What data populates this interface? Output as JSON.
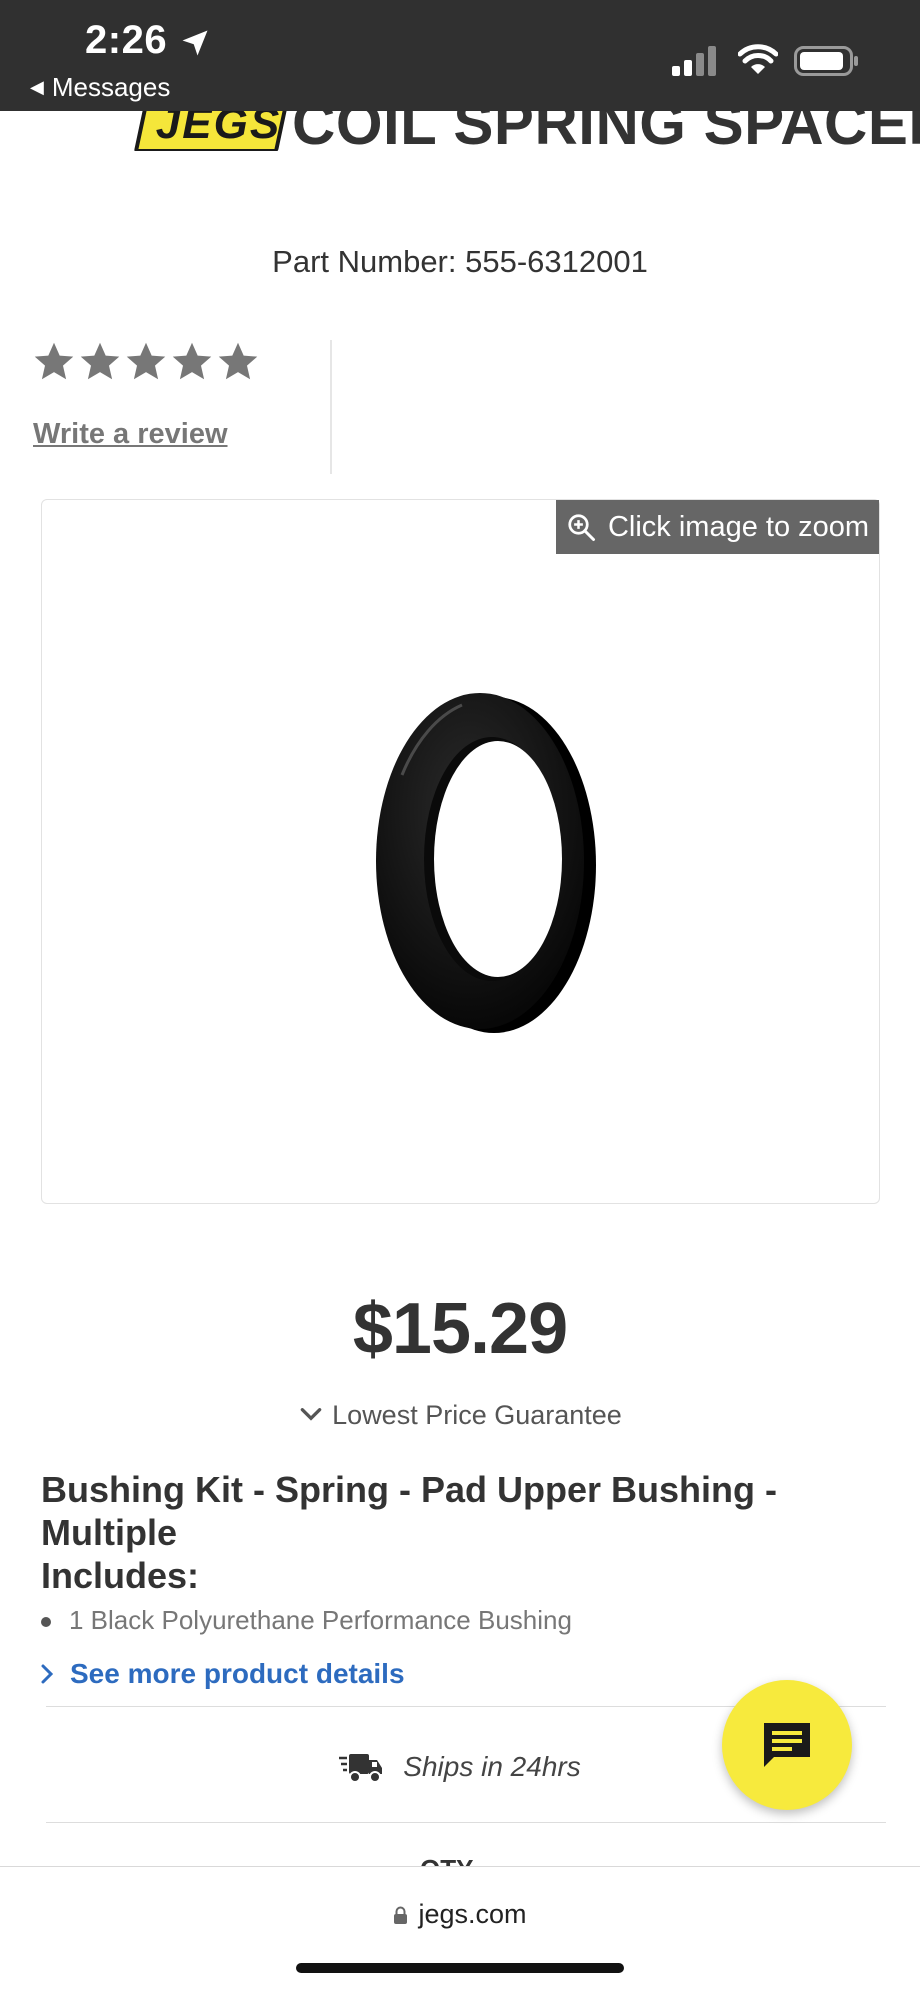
{
  "status_bar": {
    "time": "2:26",
    "back_label": "Messages"
  },
  "header": {
    "logo_text": "JEGS",
    "title": "COIL SPRING SPACER"
  },
  "product": {
    "part_number": "Part Number: 555-6312001",
    "rating_stars": 5,
    "write_review": "Write a review",
    "zoom_label": "Click image to zoom",
    "price": "$15.29",
    "price_guarantee": "Lowest Price Guarantee",
    "description_title": "Bushing Kit - Spring - Pad Upper Bushing - Multiple",
    "includes_label": "Includes:",
    "includes": [
      "1 Black Polyurethane Performance Bushing"
    ],
    "more_details": "See more product details",
    "shipping": "Ships in 24hrs",
    "qty_label": "QTY"
  },
  "browser": {
    "url": "jegs.com"
  },
  "colors": {
    "accent_yellow": "#f7ea3d",
    "link_blue": "#2d6bbf",
    "star_gray": "#777777",
    "status_bar_bg": "#303030"
  },
  "icons": {
    "location": "location-arrow-icon",
    "signal": "signal-bars-icon",
    "wifi": "wifi-icon",
    "battery": "battery-icon",
    "zoom": "zoom-in-icon",
    "chevron_down": "chevron-down-icon",
    "chevron_right": "chevron-right-icon",
    "truck": "fast-delivery-truck-icon",
    "chat": "chat-message-icon",
    "lock": "lock-icon"
  }
}
